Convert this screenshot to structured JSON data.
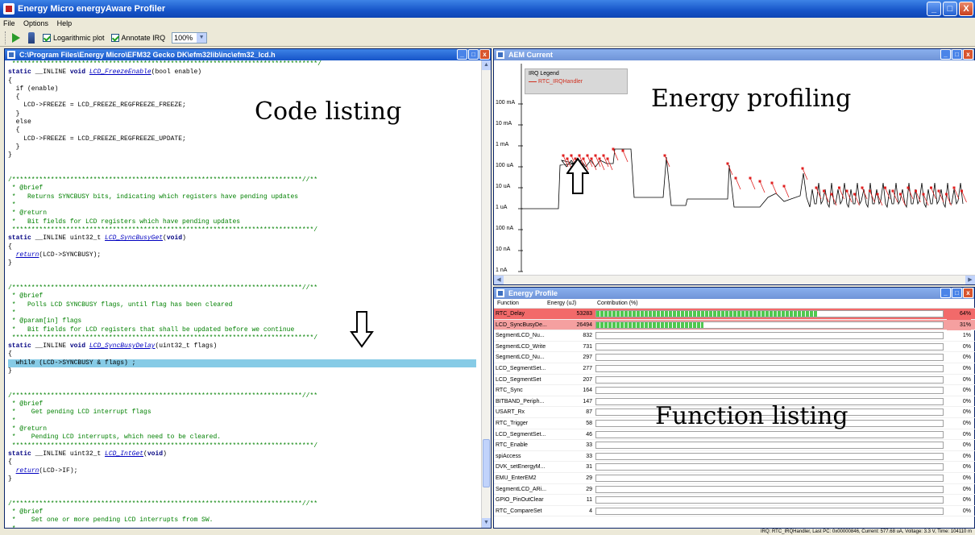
{
  "window": {
    "title": "Energy Micro energyAware Profiler",
    "controls": [
      "_",
      "□",
      "X"
    ]
  },
  "menu": [
    "File",
    "Options",
    "Help"
  ],
  "toolbar": {
    "log_label": "Logarithmic plot",
    "irq_label": "Annotate IRQ",
    "zoom": "100%"
  },
  "code_panel": {
    "title": "C:\\Program Files\\Energy Micro\\EFM32 Gecko DK\\efm32lib\\inc\\efm32_lcd.h",
    "overlay_label": "Code listing",
    "lines": [
      [
        [
          "cm",
          " *******************************************************************************/"
        ]
      ],
      [
        [
          "kw",
          "static"
        ],
        [
          "",
          " __INLINE "
        ],
        [
          "kw",
          "void"
        ],
        [
          "",
          " "
        ],
        [
          "fn",
          "LCD_FreezeEnable"
        ],
        [
          "",
          "(bool enable)"
        ]
      ],
      [
        [
          "",
          "{"
        ]
      ],
      [
        [
          "",
          "  if (enable)"
        ]
      ],
      [
        [
          "",
          "  {"
        ]
      ],
      [
        [
          "",
          "    LCD->FREEZE = LCD_FREEZE_REGFREEZE_FREEZE;"
        ]
      ],
      [
        [
          "",
          "  }"
        ]
      ],
      [
        [
          "",
          "  else"
        ]
      ],
      [
        [
          "",
          "  {"
        ]
      ],
      [
        [
          "",
          "    LCD->FREEZE = LCD_FREEZE_REGFREEZE_UPDATE;"
        ]
      ],
      [
        [
          "",
          "  }"
        ]
      ],
      [
        [
          "",
          "}"
        ]
      ],
      [
        [
          "",
          ""
        ]
      ],
      [
        [
          "",
          ""
        ]
      ],
      [
        [
          "cm",
          "/***************************************************************************//**"
        ]
      ],
      [
        [
          "cm",
          " * @brief"
        ]
      ],
      [
        [
          "cm",
          " *   Returns SYNCBUSY bits, indicating which registers have pending updates"
        ]
      ],
      [
        [
          "cm",
          " *"
        ]
      ],
      [
        [
          "cm",
          " * @return"
        ]
      ],
      [
        [
          "cm",
          " *   Bit fields for LCD registers which have pending updates"
        ]
      ],
      [
        [
          "cm",
          " ******************************************************************************/"
        ]
      ],
      [
        [
          "kw",
          "static"
        ],
        [
          "",
          " __INLINE uint32_t "
        ],
        [
          "fn",
          "LCD_SyncBusyGet"
        ],
        [
          "",
          "("
        ],
        [
          "kw",
          "void"
        ],
        [
          "",
          ")"
        ]
      ],
      [
        [
          "",
          "{"
        ]
      ],
      [
        [
          "",
          "  "
        ],
        [
          "fn",
          "return"
        ],
        [
          "",
          "(LCD->SYNCBUSY);"
        ]
      ],
      [
        [
          "",
          "}"
        ]
      ],
      [
        [
          "",
          ""
        ]
      ],
      [
        [
          "",
          ""
        ]
      ],
      [
        [
          "cm",
          "/***************************************************************************//**"
        ]
      ],
      [
        [
          "cm",
          " * @brief"
        ]
      ],
      [
        [
          "cm",
          " *   Polls LCD SYNCBUSY flags, until flag has been cleared"
        ]
      ],
      [
        [
          "cm",
          " *"
        ]
      ],
      [
        [
          "cm",
          " * @param[in] flags"
        ]
      ],
      [
        [
          "cm",
          " *   Bit fields for LCD registers that shall be updated before we continue"
        ]
      ],
      [
        [
          "cm",
          " ******************************************************************************/"
        ]
      ],
      [
        [
          "kw",
          "static"
        ],
        [
          "",
          " __INLINE "
        ],
        [
          "kw",
          "void"
        ],
        [
          "",
          " "
        ],
        [
          "fn",
          "LCD_SyncBusyDelay"
        ],
        [
          "",
          "(uint32_t flags)"
        ]
      ],
      [
        [
          "",
          "{"
        ]
      ],
      [
        [
          "hl",
          "  while (LCD->SYNCBUSY & flags) ;"
        ]
      ],
      [
        [
          "",
          "}"
        ]
      ],
      [
        [
          "",
          ""
        ]
      ],
      [
        [
          "",
          ""
        ]
      ],
      [
        [
          "cm",
          "/***************************************************************************//**"
        ]
      ],
      [
        [
          "cm",
          " * @brief"
        ]
      ],
      [
        [
          "cm",
          " *    Get pending LCD interrupt flags"
        ]
      ],
      [
        [
          "cm",
          " *"
        ]
      ],
      [
        [
          "cm",
          " * @return"
        ]
      ],
      [
        [
          "cm",
          " *    Pending LCD interrupts, which need to be cleared."
        ]
      ],
      [
        [
          "cm",
          " ******************************************************************************/"
        ]
      ],
      [
        [
          "kw",
          "static"
        ],
        [
          "",
          " __INLINE uint32_t "
        ],
        [
          "fn",
          "LCD_IntGet"
        ],
        [
          "",
          "("
        ],
        [
          "kw",
          "void"
        ],
        [
          "",
          ")"
        ]
      ],
      [
        [
          "",
          "{"
        ]
      ],
      [
        [
          "",
          "  "
        ],
        [
          "fn",
          "return"
        ],
        [
          "",
          "(LCD->IF);"
        ]
      ],
      [
        [
          "",
          "}"
        ]
      ],
      [
        [
          "",
          ""
        ]
      ],
      [
        [
          "",
          ""
        ]
      ],
      [
        [
          "cm",
          "/***************************************************************************//**"
        ]
      ],
      [
        [
          "cm",
          " * @brief"
        ]
      ],
      [
        [
          "cm",
          " *    Set one or more pending LCD interrupts from SW."
        ]
      ],
      [
        [
          "cm",
          " *"
        ]
      ]
    ]
  },
  "aem_panel": {
    "title": "AEM Current",
    "overlay_label": "Energy profiling",
    "legend_title": "IRQ Legend",
    "legend_item": "RTC_IRQHandler",
    "y_ticks": [
      "100 mA",
      "10 mA",
      "1 mA",
      "100 uA",
      "10 uA",
      "1 uA",
      "100 nA",
      "10 nA",
      "1 nA"
    ],
    "colors": {
      "trace": "#000000",
      "irq": "#e02020",
      "marker": "#22cc22"
    }
  },
  "profile_panel": {
    "title": "Energy Profile",
    "overlay_label": "Function listing",
    "headers": {
      "function": "Function",
      "energy": "Energy (uJ)",
      "contribution": "Contribution (%)"
    },
    "rows": [
      {
        "name": "RTC_Delay",
        "energy": "53283",
        "pct": "64%",
        "fraction": 0.64
      },
      {
        "name": "LCD_SyncBusyDe...",
        "energy": "26494",
        "pct": "31%",
        "fraction": 0.31
      },
      {
        "name": "SegmentLCD_Nu...",
        "energy": "832",
        "pct": "1%",
        "fraction": 0.0
      },
      {
        "name": "SegmentLCD_Write",
        "energy": "731",
        "pct": "0%",
        "fraction": 0.0
      },
      {
        "name": "SegmentLCD_Nu...",
        "energy": "297",
        "pct": "0%",
        "fraction": 0.0
      },
      {
        "name": "LCD_SegmentSet...",
        "energy": "277",
        "pct": "0%",
        "fraction": 0.0
      },
      {
        "name": "LCD_SegmentSet",
        "energy": "207",
        "pct": "0%",
        "fraction": 0.0
      },
      {
        "name": "RTC_Sync",
        "energy": "164",
        "pct": "0%",
        "fraction": 0.0
      },
      {
        "name": "BITBAND_Periph...",
        "energy": "147",
        "pct": "0%",
        "fraction": 0.0
      },
      {
        "name": "USART_Rx",
        "energy": "87",
        "pct": "0%",
        "fraction": 0.0
      },
      {
        "name": "RTC_Trigger",
        "energy": "58",
        "pct": "0%",
        "fraction": 0.0
      },
      {
        "name": "LCD_SegmentSet...",
        "energy": "46",
        "pct": "0%",
        "fraction": 0.0
      },
      {
        "name": "RTC_Enable",
        "energy": "33",
        "pct": "0%",
        "fraction": 0.0
      },
      {
        "name": "spiAccess",
        "energy": "33",
        "pct": "0%",
        "fraction": 0.0
      },
      {
        "name": "DVK_setEnergyM...",
        "energy": "31",
        "pct": "0%",
        "fraction": 0.0
      },
      {
        "name": "EMU_EnterEM2",
        "energy": "29",
        "pct": "0%",
        "fraction": 0.0
      },
      {
        "name": "SegmentLCD_ARi...",
        "energy": "29",
        "pct": "0%",
        "fraction": 0.0
      },
      {
        "name": "GPIO_PinOutClear",
        "energy": "11",
        "pct": "0%",
        "fraction": 0.0
      },
      {
        "name": "RTC_CompareSet",
        "energy": "4",
        "pct": "0%",
        "fraction": 0.0
      }
    ]
  },
  "status": "IRQ: RTC_IRQHandler, Last PC: 0x00000846, Current: 577.68 uA, Voltage: 3.3 V, Time: 104110 m"
}
